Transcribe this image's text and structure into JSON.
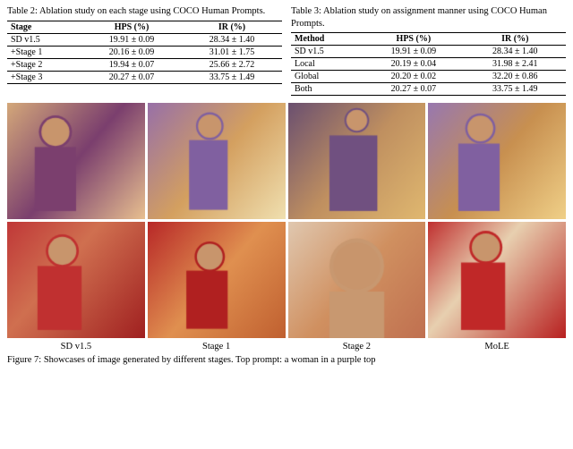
{
  "table2": {
    "caption": "Table 2:  Ablation study on each stage using COCO Human Prompts.",
    "headers": [
      "Stage",
      "HPS (%)",
      "IR (%)"
    ],
    "rows": [
      [
        "SD v1.5",
        "19.91 ± 0.09",
        "28.34 ± 1.40"
      ],
      [
        "+Stage 1",
        "20.16 ± 0.09",
        "31.01 ± 1.75"
      ],
      [
        "+Stage 2",
        "19.94 ± 0.07",
        "25.66 ± 2.72"
      ],
      [
        "+Stage 3",
        "20.27 ± 0.07",
        "33.75 ± 1.49"
      ]
    ]
  },
  "table3": {
    "caption": "Table 3:  Ablation study on assignment manner using COCO Human Prompts.",
    "headers": [
      "Method",
      "HPS (%)",
      "IR (%)"
    ],
    "rows": [
      [
        "SD v1.5",
        "19.91 ± 0.09",
        "28.34 ± 1.40"
      ],
      [
        "Local",
        "20.19 ± 0.04",
        "31.98 ± 2.41"
      ],
      [
        "Global",
        "20.20 ± 0.02",
        "32.20 ± 0.86"
      ],
      [
        "Both",
        "20.27 ± 0.07",
        "33.75 ± 1.49"
      ]
    ]
  },
  "image_labels": [
    "SD v1.5",
    "Stage 1",
    "Stage 2",
    "MoLE"
  ],
  "figure_caption": "Figure 7: Showcases of image generated by different stages. Top prompt: a woman in a purple top"
}
